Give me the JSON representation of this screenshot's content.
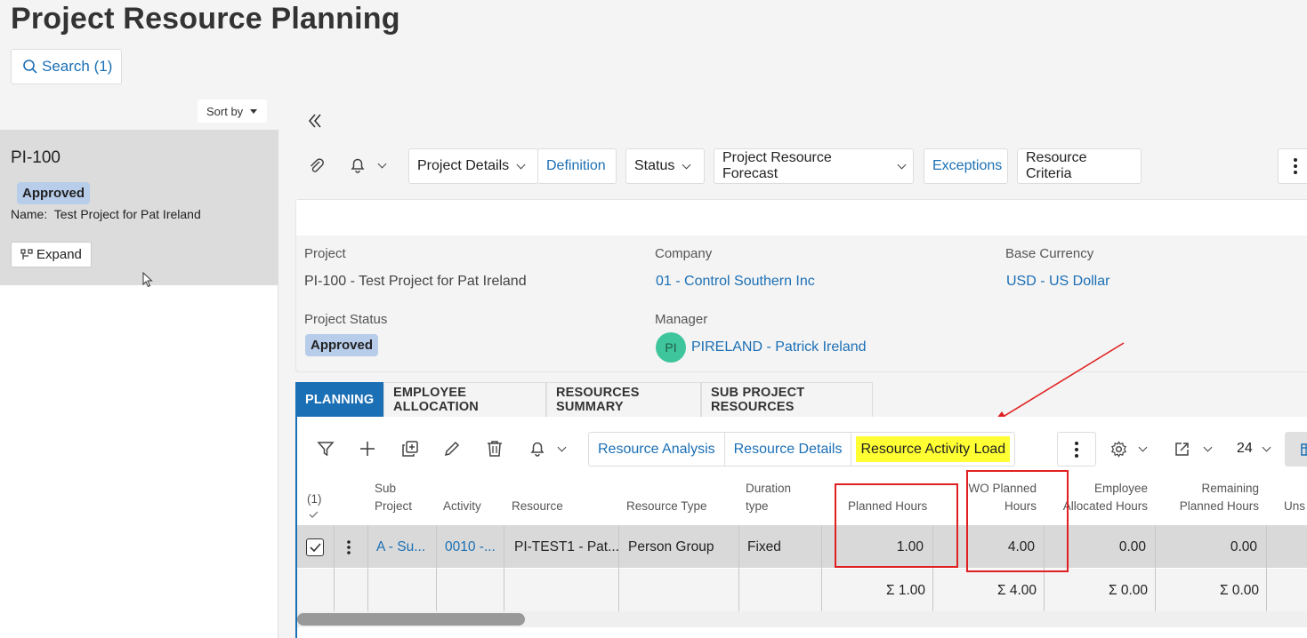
{
  "page": {
    "title": "Project Resource Planning"
  },
  "search": {
    "label": "Search (1)"
  },
  "list": {
    "sort_label": "Sort by",
    "card": {
      "id": "PI-100",
      "status": "Approved",
      "name_label": "Name:",
      "name_value": "Test Project for Pat Ireland",
      "expand_label": "Expand"
    }
  },
  "toolbar": {
    "project_details": "Project Details",
    "definition": "Definition",
    "status": "Status",
    "forecast": "Project Resource Forecast",
    "exceptions": "Exceptions",
    "criteria": "Resource Criteria"
  },
  "header": {
    "project_label": "Project",
    "project_value": "PI-100 - Test Project for Pat Ireland",
    "company_label": "Company",
    "company_value": "01 - Control Southern Inc",
    "currency_label": "Base Currency",
    "currency_value": "USD - US Dollar",
    "status_label": "Project Status",
    "status_value": "Approved",
    "manager_label": "Manager",
    "manager_initials": "PI",
    "manager_value": "PIRELAND - Patrick Ireland"
  },
  "tabs": [
    {
      "label": "PLANNING",
      "active": true
    },
    {
      "label": "EMPLOYEE ALLOCATION",
      "active": false
    },
    {
      "label": "RESOURCES SUMMARY",
      "active": false
    },
    {
      "label": "SUB PROJECT RESOURCES",
      "active": false
    }
  ],
  "grid": {
    "commands": {
      "analysis": "Resource Analysis",
      "details": "Resource Details",
      "activity_load": "Resource Activity Load"
    },
    "page_size": "24",
    "selection_count": "(1)",
    "columns": {
      "sub_project": [
        "Sub",
        "Project"
      ],
      "activity": "Activity",
      "resource": "Resource",
      "resource_type": "Resource Type",
      "duration_type": [
        "Duration",
        "type"
      ],
      "planned_hours": "Planned Hours",
      "wo_planned_hours": [
        "WO Planned",
        "Hours"
      ],
      "employee_allocated": [
        "Employee",
        "Allocated Hours"
      ],
      "remaining_planned": [
        "Remaining",
        "Planned Hours"
      ],
      "unspecified": "Uns"
    },
    "rows": [
      {
        "sub_project": "A - Su...",
        "activity": "0010 -...",
        "resource": "PI-TEST1 - Pat...",
        "resource_type": "Person Group",
        "duration_type": "Fixed",
        "planned_hours": "1.00",
        "wo_planned_hours": "4.00",
        "employee_allocated": "0.00",
        "remaining_planned": "0.00"
      }
    ],
    "totals": {
      "planned_hours": "Σ 1.00",
      "wo_planned_hours": "Σ 4.00",
      "employee_allocated": "Σ 0.00",
      "remaining_planned": "Σ 0.00"
    }
  },
  "colors": {
    "accent": "#1b6fb5",
    "highlight": "#ffff33",
    "annotation": "#e02020"
  }
}
